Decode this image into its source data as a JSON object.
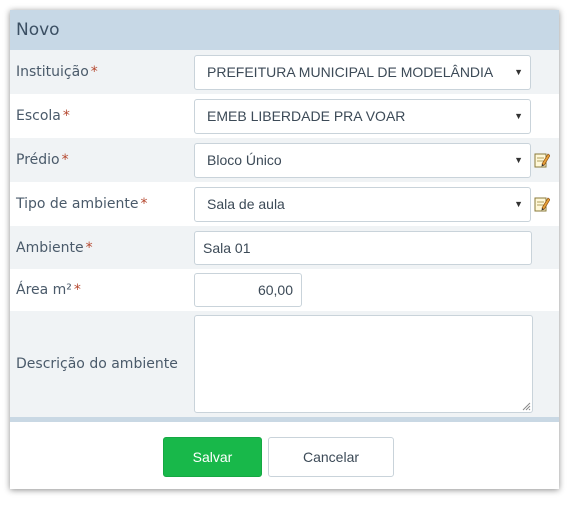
{
  "dialog": {
    "title": "Novo"
  },
  "fields": {
    "instituicao": {
      "label": "Instituição",
      "required_mark": "*",
      "value": "PREFEITURA MUNICIPAL DE MODELÂNDIA",
      "arrow": "▼"
    },
    "escola": {
      "label": "Escola",
      "required_mark": "*",
      "value": "EMEB LIBERDADE PRA VOAR",
      "arrow": "▼"
    },
    "predio": {
      "label": "Prédio",
      "required_mark": "*",
      "value": "Bloco Único",
      "arrow": "▼"
    },
    "tipo_ambiente": {
      "label": "Tipo de ambiente",
      "required_mark": "*",
      "value": "Sala de aula",
      "arrow": "▼"
    },
    "ambiente": {
      "label": "Ambiente",
      "required_mark": "*",
      "value": "Sala 01"
    },
    "area": {
      "label": "Área m²",
      "required_mark": "*",
      "value": "60,00"
    },
    "descricao": {
      "label": "Descrição do ambiente",
      "value": ""
    }
  },
  "buttons": {
    "save": "Salvar",
    "cancel": "Cancelar"
  },
  "colors": {
    "header_bg": "#c7d8e6",
    "save_bg": "#18b84a",
    "required": "#b5472e"
  },
  "icons": {
    "edit": "pencil-note-icon",
    "dropdown": "caret-down-icon"
  }
}
